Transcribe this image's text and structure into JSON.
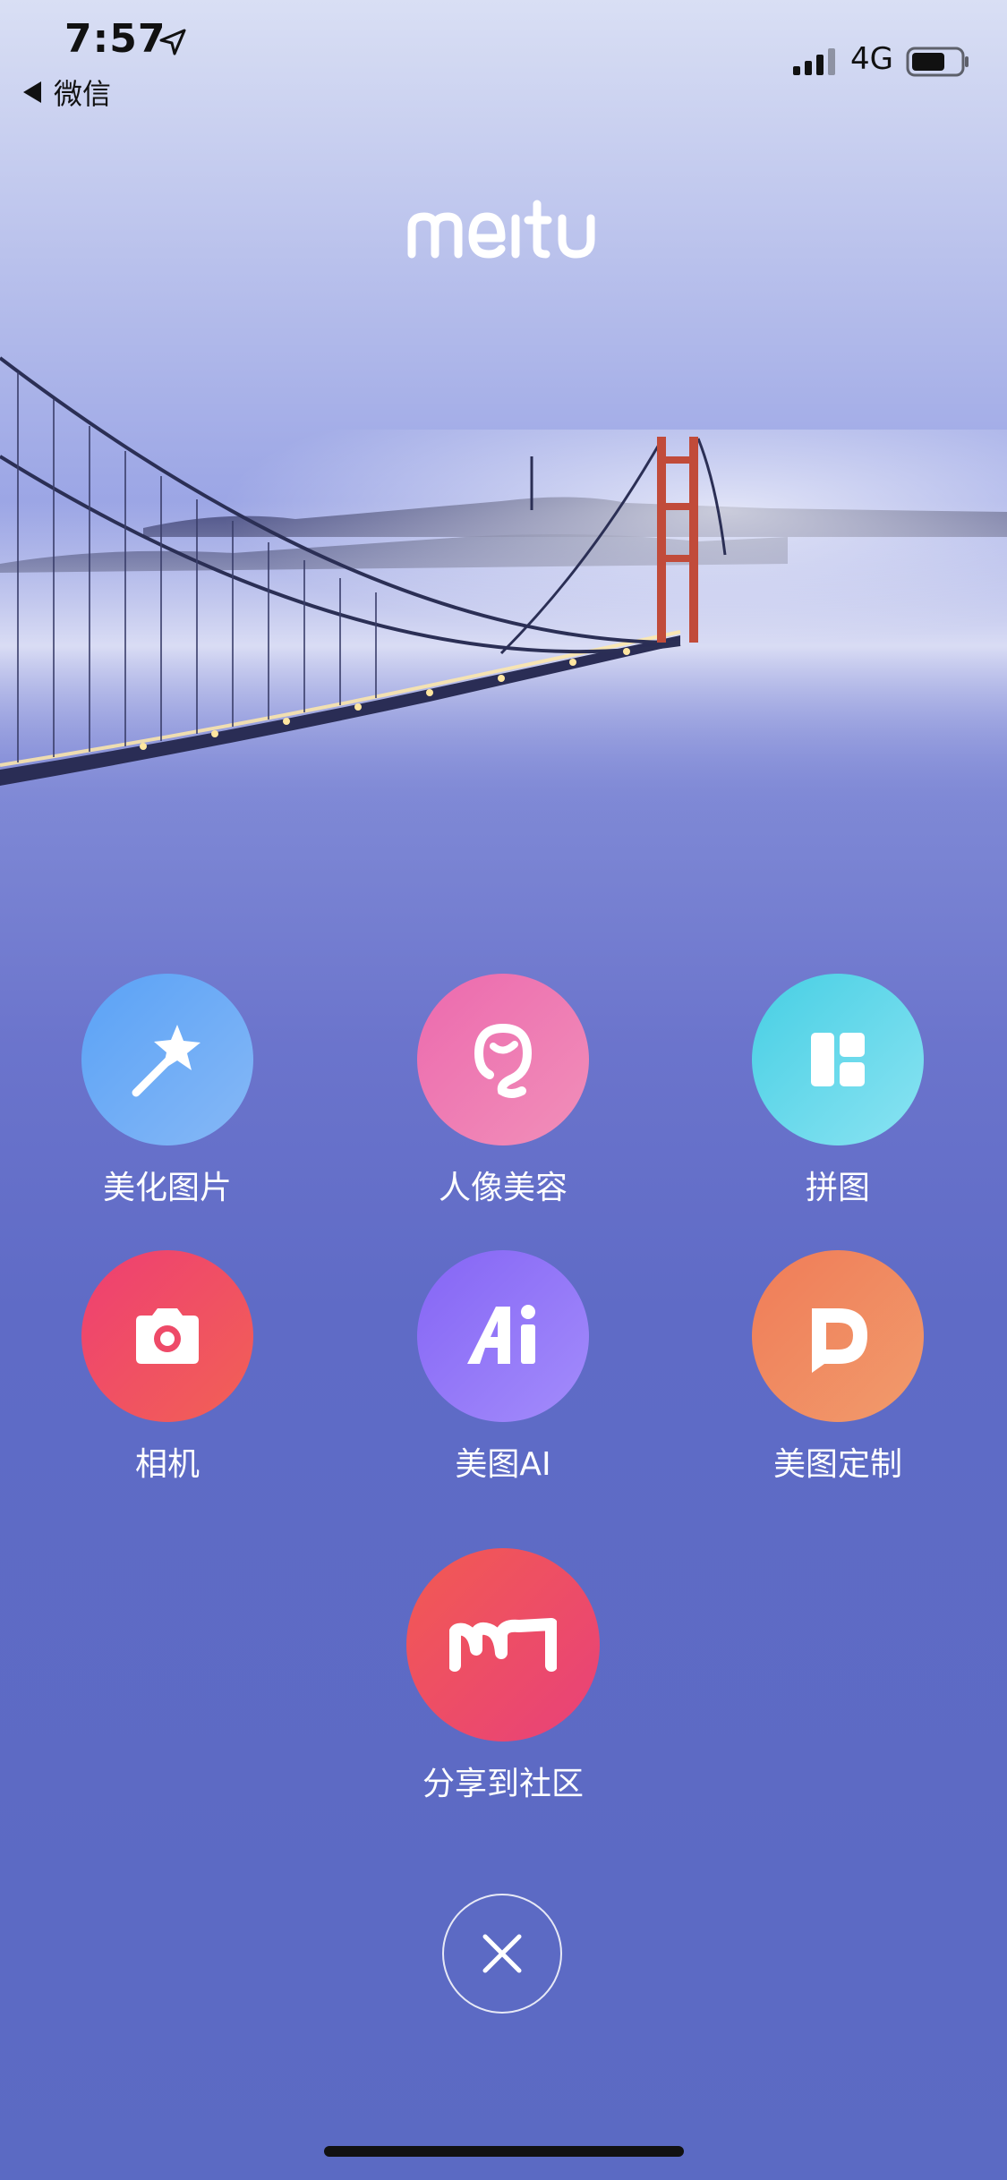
{
  "status_bar": {
    "time": "7:57",
    "back_label": "微信",
    "network": "4G"
  },
  "logo": {
    "text": "meitu"
  },
  "actions": [
    {
      "label": "美化图片",
      "icon": "magic-wand-icon",
      "color_from": "#5aa5f7",
      "color_to": "#7fb4f5"
    },
    {
      "label": "人像美容",
      "icon": "face-outline-icon",
      "color_from": "#ee6fb3",
      "color_to": "#f08ab6"
    },
    {
      "label": "拼图",
      "icon": "collage-grid-icon",
      "color_from": "#4fd3e6",
      "color_to": "#82e1f2"
    },
    {
      "label": "相机",
      "icon": "camera-icon",
      "color_from": "#ee3f6f",
      "color_to": "#f25f5a"
    },
    {
      "label": "美图AI",
      "icon": "ai-icon",
      "color_from": "#8a6ef6",
      "color_to": "#9e86fa"
    },
    {
      "label": "美图定制",
      "icon": "custom-d-icon",
      "color_from": "#f0845e",
      "color_to": "#ef9a6a"
    },
    {
      "label": "分享到社区",
      "icon": "meitu-m-icon",
      "color_from": "#ef5a5a",
      "color_to": "#e94378"
    }
  ],
  "close": {
    "icon": "close-icon"
  }
}
